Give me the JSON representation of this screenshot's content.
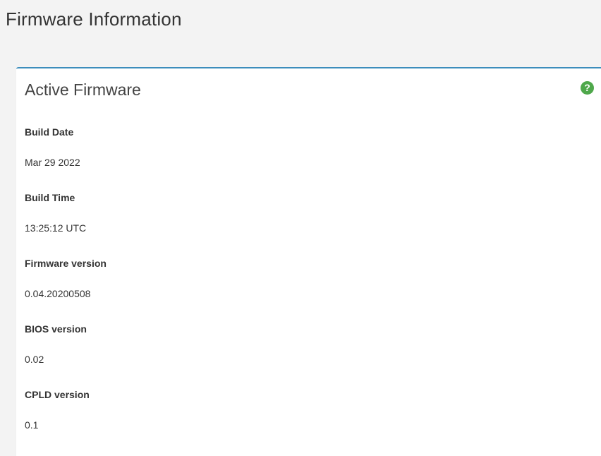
{
  "page": {
    "title": "Firmware Information"
  },
  "panel": {
    "title": "Active Firmware",
    "help_icon": "question-circle-icon",
    "accent_color": "#3c8dbc",
    "help_color": "#4fa84b",
    "fields": [
      {
        "label": "Build Date",
        "value": "Mar 29 2022"
      },
      {
        "label": "Build Time",
        "value": "13:25:12 UTC"
      },
      {
        "label": "Firmware version",
        "value": "0.04.20200508"
      },
      {
        "label": "BIOS version",
        "value": "0.02"
      },
      {
        "label": "CPLD version",
        "value": "0.1"
      }
    ]
  }
}
